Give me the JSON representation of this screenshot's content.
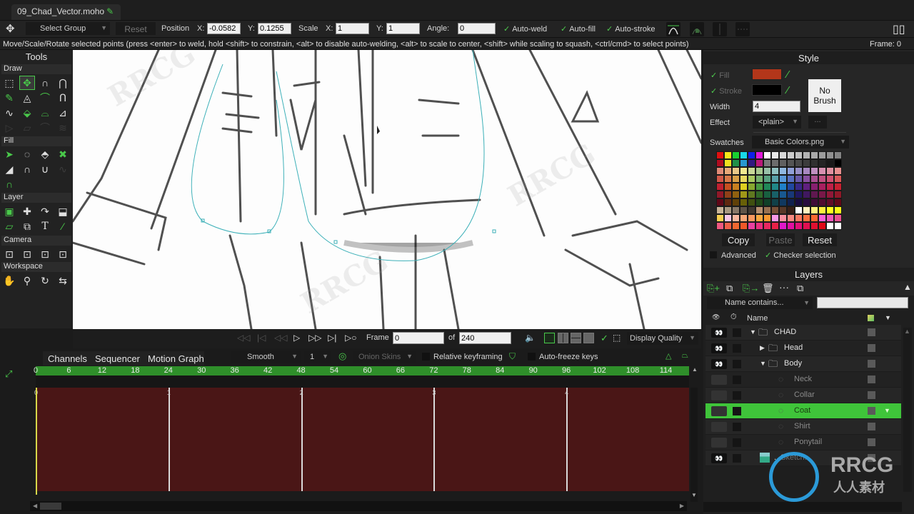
{
  "document_tab": {
    "title": "09_Chad_Vector.moho"
  },
  "tool_options": {
    "group_select": "Select Group",
    "reset_label": "Reset",
    "position_label": "Position",
    "pos_x_label": "X:",
    "pos_x": "-0.0582",
    "pos_y_label": "Y:",
    "pos_y": "0.1255",
    "scale_label": "Scale",
    "scale_x_label": "X:",
    "scale_x": "1",
    "scale_y_label": "Y:",
    "scale_y": "1",
    "angle_label": "Angle:",
    "angle": "0",
    "auto_weld": "Auto-weld",
    "auto_fill": "Auto-fill",
    "auto_stroke": "Auto-stroke"
  },
  "status": {
    "message": "Move/Scale/Rotate selected points (press <enter> to weld, hold <shift> to constrain, <alt> to disable auto-welding, <alt> to scale to center, <shift> while scaling to squash, <ctrl/cmd> to select points)",
    "frame": "Frame: 0"
  },
  "tools_panel": {
    "title": "Tools",
    "sections": {
      "draw": "Draw",
      "fill": "Fill",
      "layer": "Layer",
      "camera": "Camera",
      "workspace": "Workspace"
    }
  },
  "style_panel": {
    "title": "Style",
    "fill_label": "Fill",
    "stroke_label": "Stroke",
    "fill_color": "#b3361a",
    "stroke_color": "#000000",
    "no_brush_line1": "No",
    "no_brush_line2": "Brush",
    "width_label": "Width",
    "width_value": "4",
    "effect_label": "Effect",
    "effect_value": "<plain>",
    "effect_more": "...",
    "swatches_label": "Swatches",
    "swatches_file": "Basic Colors.png",
    "copy_label": "Copy",
    "paste_label": "Paste",
    "reset_label": "Reset",
    "advanced_label": "Advanced",
    "checker_label": "Checker selection",
    "swatch_rows": [
      [
        "#e01010",
        "#f7e81a",
        "#18d030",
        "#18d8e8",
        "#1020e8",
        "#e018d8",
        "#ffffff",
        "#e8e8e8",
        "#d8d8d8",
        "#cccccc",
        "#c0c0c0",
        "#b4b4b4",
        "#a8a8a8",
        "#9c9c9c",
        "#909090",
        "#848484"
      ],
      [
        "#b00c20",
        "#f0e020",
        "#209048",
        "#2898d0",
        "#301880",
        "#b81878",
        "#787878",
        "#6c6c6c",
        "#606060",
        "#545454",
        "#484848",
        "#3c3c3c",
        "#303030",
        "#242424",
        "#181818",
        "#000000"
      ],
      [
        "#e08c78",
        "#e8a878",
        "#e8c888",
        "#f0e890",
        "#c8d898",
        "#a8c890",
        "#98c0a8",
        "#90c0c0",
        "#90b8e0",
        "#90a0d8",
        "#9890c8",
        "#a888c0",
        "#c090c0",
        "#d890b0",
        "#e090a0",
        "#e89090"
      ],
      [
        "#d05848",
        "#d87848",
        "#d8a048",
        "#e8d860",
        "#a8c860",
        "#78b070",
        "#58a080",
        "#58a0a8",
        "#5898d8",
        "#5870c0",
        "#6858a8",
        "#8850a0",
        "#a85090",
        "#c05080",
        "#d05070",
        "#d85858"
      ],
      [
        "#c02030",
        "#c85020",
        "#c88020",
        "#e0d020",
        "#88a830",
        "#489840",
        "#208858",
        "#208888",
        "#2080c8",
        "#2048a0",
        "#382888",
        "#602080",
        "#882070",
        "#a82060",
        "#c02048",
        "#c82030"
      ],
      [
        "#901828",
        "#904018",
        "#906010",
        "#a09818",
        "#607820",
        "#306828",
        "#186040",
        "#186068",
        "#185890",
        "#183878",
        "#201860",
        "#401860",
        "#601850",
        "#781848",
        "#901838",
        "#901828"
      ],
      [
        "#600818",
        "#602810",
        "#604008",
        "#686008",
        "#405010",
        "#204818",
        "#104028",
        "#104048",
        "#103860",
        "#102050",
        "#180c40",
        "#280c40",
        "#400c38",
        "#500c30",
        "#600c28",
        "#600818"
      ],
      [
        "#c8b498",
        "#a89880",
        "#887868",
        "#605448",
        "#403830",
        "#b89070",
        "#987050",
        "#785038",
        "#583828",
        "#382018",
        "#ffffff",
        "#fff0c0",
        "#fff080",
        "#fff040",
        "#ffff20",
        "#f8f818"
      ],
      [
        "#f8d050",
        "#f8c8e8",
        "#f8b8a0",
        "#f8a878",
        "#f89860",
        "#f8a840",
        "#f89830",
        "#f898e8",
        "#f890a0",
        "#f88880",
        "#f87860",
        "#f87040",
        "#f86830",
        "#f860d8",
        "#f058b8",
        "#e85090"
      ],
      [
        "#f05880",
        "#f06048",
        "#f06830",
        "#f05828",
        "#e840a0",
        "#e83080",
        "#e82860",
        "#e82048",
        "#e018c8",
        "#e010a0",
        "#e01078",
        "#e01050",
        "#e01030",
        "#e00818",
        "#ffffff",
        "#ffffff"
      ]
    ]
  },
  "layers_panel": {
    "title": "Layers",
    "filter_placeholder": "Name contains...",
    "filter_value": "",
    "name_header": "Name",
    "layers": [
      {
        "name": "CHAD",
        "type": "group",
        "expanded": true,
        "visible": true,
        "selected": false
      },
      {
        "name": "Head",
        "type": "group",
        "expanded": false,
        "visible": true,
        "selected": false
      },
      {
        "name": "Body",
        "type": "group",
        "expanded": true,
        "visible": true,
        "selected": false
      },
      {
        "name": "Neck",
        "type": "vector",
        "visible": false,
        "selected": false
      },
      {
        "name": "Collar",
        "type": "vector",
        "visible": false,
        "selected": false
      },
      {
        "name": "Coat",
        "type": "vector",
        "visible": false,
        "selected": true
      },
      {
        "name": "Shirt",
        "type": "vector",
        "visible": false,
        "selected": false
      },
      {
        "name": "Ponytail",
        "type": "vector",
        "visible": false,
        "selected": false
      },
      {
        "name": "...Sketch...",
        "type": "image",
        "visible": true,
        "selected": false
      }
    ]
  },
  "transport": {
    "frame_label": "Frame",
    "frame_value": "0",
    "of_label": "of",
    "total_frames": "240",
    "display_quality": "Display Quality"
  },
  "timeline": {
    "tabs": [
      "Channels",
      "Sequencer",
      "Motion Graph"
    ],
    "interpolation": "Smooth",
    "interp_value": "1",
    "onion_skins": "Onion Skins",
    "relative_keyframing": "Relative keyframing",
    "auto_freeze": "Auto-freeze keys",
    "ruler_ticks": [
      "0",
      "6",
      "12",
      "18",
      "24",
      "30",
      "36",
      "42",
      "48",
      "54",
      "60",
      "66",
      "72",
      "78",
      "84",
      "90",
      "96",
      "102",
      "108",
      "114"
    ],
    "seconds": [
      "0",
      "1",
      "2",
      "3",
      "4"
    ],
    "current_frame": 0
  },
  "watermark": {
    "text1": "RRCG",
    "text2": "人人素材"
  }
}
